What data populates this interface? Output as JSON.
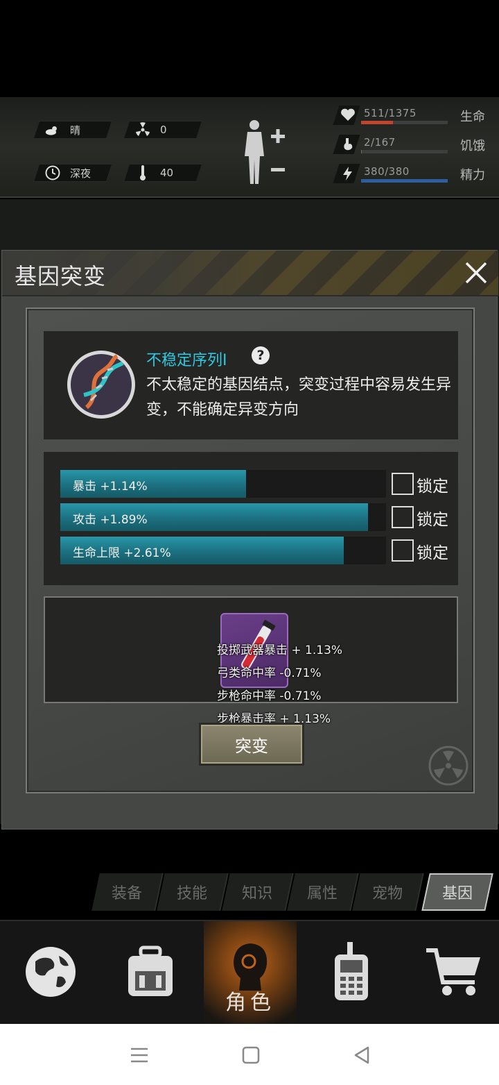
{
  "hud": {
    "weather": "晴",
    "radiation": "0",
    "time_of_day": "深夜",
    "temperature": "40",
    "stats": [
      {
        "value": "511/1375",
        "label": "生命",
        "fraction": 0.37,
        "color": "#c0452c",
        "icon": "heart-icon"
      },
      {
        "value": "2/167",
        "label": "饥饿",
        "fraction": 0.01,
        "color": "#6a6a6a",
        "icon": "stomach-icon"
      },
      {
        "value": "380/380",
        "label": "精力",
        "fraction": 1.0,
        "color": "#2f5e9e",
        "icon": "energy-icon"
      }
    ]
  },
  "modal": {
    "title": "基因突变",
    "gene": {
      "name": "不稳定序列Ⅰ",
      "help": "?",
      "description": "不太稳定的基因结点，突变过程中容易发生异变，不能确定异变方向"
    },
    "gene_stats": [
      {
        "text": "暴击 +1.14%",
        "fill": 0.57,
        "lock_label": "锁定",
        "locked": false
      },
      {
        "text": "攻击 +1.89%",
        "fill": 0.945,
        "lock_label": "锁定",
        "locked": false
      },
      {
        "text": "生命上限 +2.61%",
        "fill": 0.87,
        "lock_label": "锁定",
        "locked": false
      }
    ],
    "reward_item": {
      "icon": "red-vial-icon",
      "lines": [
        "投掷武器暴击 + 1.13%",
        "弓类命中率 -0.71%",
        "步枪命中率 -0.71%",
        "步枪暴击率 + 1.13%"
      ]
    },
    "mutate_button": "突变"
  },
  "sub_tabs": [
    "装备",
    "技能",
    "知识",
    "属性",
    "宠物",
    "基因"
  ],
  "sub_tab_active": "基因",
  "bottom_nav": {
    "items": [
      "globe-icon",
      "backpack-icon",
      "character-icon",
      "walkie-talkie-icon",
      "cart-icon"
    ],
    "active_label": "角色"
  },
  "colors": {
    "accent_cyan": "#2ec9e0",
    "bar_teal": "#1c7080",
    "health_red": "#c0452c",
    "energy_blue": "#2f5e9e"
  }
}
